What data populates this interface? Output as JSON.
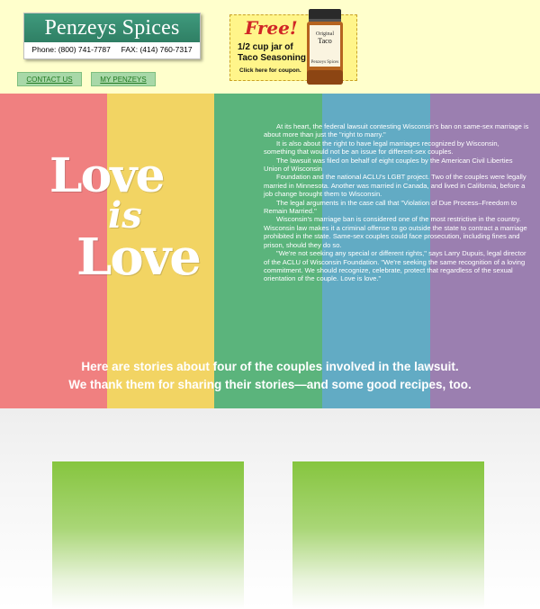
{
  "header": {
    "logo_title": "Penzeys Spices",
    "logo_phone": "Phone: (800) 741-7787     FAX: (414) 760-7317",
    "coupon": {
      "free": "Free!",
      "line1": "1/2 cup jar of",
      "line2": "Taco Seasoning",
      "cta": "Click here for coupon.",
      "jar_label_top": "Original",
      "jar_label_main": "Taco",
      "jar_brand": "Penzeys Spices"
    },
    "nav": [
      {
        "label": "CONTACT US"
      },
      {
        "label": "MY PENZEYS"
      }
    ]
  },
  "banner": {
    "stripe_colors": [
      "#f08080",
      "#f2d463",
      "#5bb47c",
      "#62abc4",
      "#9b7fb0"
    ],
    "love_line1": "Love",
    "love_line2": "is",
    "love_line3": "Love",
    "paragraphs": [
      "At its heart, the federal lawsuit contesting Wisconsin's ban on same-sex marriage is about more than just the \"right to marry.\"",
      "It is also about the right to have legal marriages recognized by Wisconsin, something that would not be an issue for different-sex couples.",
      "The lawsuit was filed on behalf of eight couples by the American Civil Liberties Union of Wisconsin",
      "Foundation and the national ACLU's LGBT project. Two of the couples were legally married in Minnesota. Another was married in Canada, and lived in California, before a job change brought them to Wisconsin.",
      "The legal arguments in the case call that \"Violation of Due Process–Freedom to Remain Married.\"",
      "Wisconsin's marriage ban is considered one of the most restrictive in the country. Wisconsin law makes it a criminal offense to go outside the state to contract a marriage prohibited in the state. Same-sex couples could face prosecution, including fines and prison, should they do so.",
      "\"We're not seeking any special or different rights,\" says Larry Dupuis, legal director of the ACLU of Wisconsin Foundation. \"We're seeking the same recognition of a loving commitment. We should recognize, celebrate, protect that regardless of the sexual orientation of the couple. Love is love.\""
    ],
    "tagline1": "Here are stories about four of the couples involved in the lawsuit.",
    "tagline2": "We thank them for sharing their stories—and some good recipes, too."
  }
}
